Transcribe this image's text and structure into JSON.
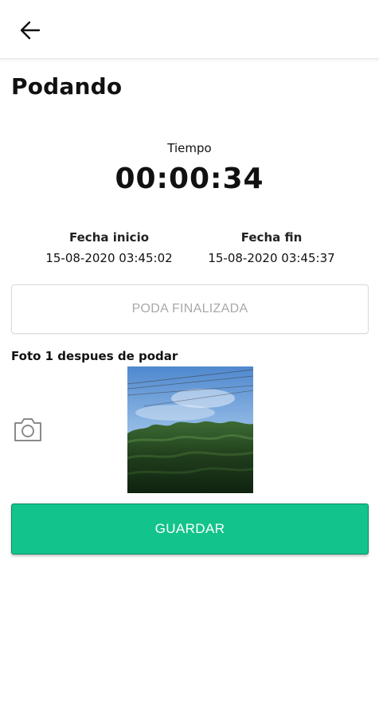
{
  "header": {
    "back_icon": "arrow-left-icon",
    "title": "Podando"
  },
  "timer": {
    "label": "Tiempo",
    "value": "00:00:34"
  },
  "dates": {
    "start_label": "Fecha inicio",
    "start_value": "15-08-2020 03:45:02",
    "end_label": "Fecha fin",
    "end_value": "15-08-2020 03:45:37"
  },
  "status": {
    "placeholder": "PODA FINALIZADA"
  },
  "photo": {
    "label": "Foto 1 despues de podar",
    "camera_icon": "camera-icon"
  },
  "actions": {
    "save_label": "GUARDAR"
  },
  "colors": {
    "accent": "#12c48b",
    "placeholder_text": "#a9a9a9"
  }
}
